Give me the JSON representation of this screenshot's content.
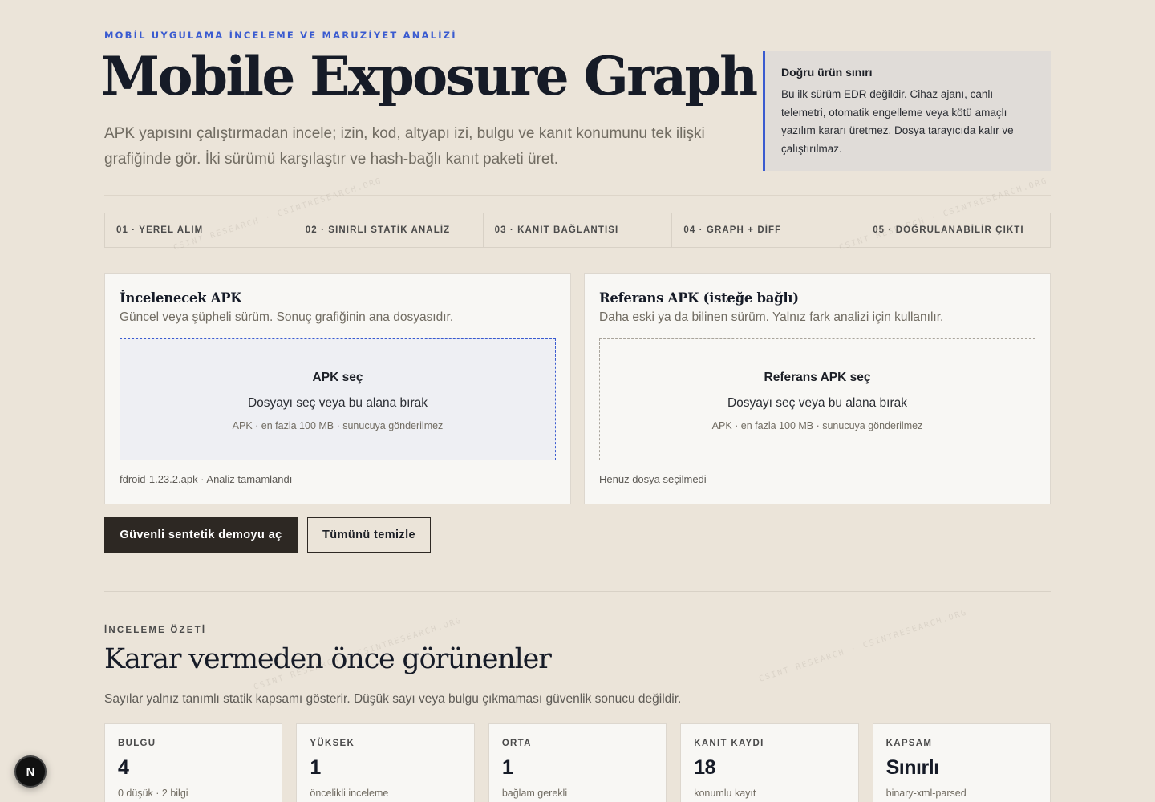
{
  "hero": {
    "eyebrow": "MOBİL UYGULAMA İNCELEME VE MARUZİYET ANALİZİ",
    "title": "Mobile Exposure Graph",
    "subtitle": "APK yapısını çalıştırmadan incele; izin, kod, altyapı izi, bulgu ve kanıt konumunu tek ilişki grafiğinde gör. İki sürümü karşılaştır ve hash-bağlı kanıt paketi üret."
  },
  "notice": {
    "title": "Doğru ürün sınırı",
    "body": "Bu ilk sürüm EDR değildir. Cihaz ajanı, canlı telemetri, otomatik engelleme veya kötü amaçlı yazılım kararı üretmez. Dosya tarayıcıda kalır ve çalıştırılmaz."
  },
  "steps": [
    {
      "label": "01 · YEREL ALIM"
    },
    {
      "label": "02 · SINIRLI STATİK ANALİZ"
    },
    {
      "label": "03 · KANIT BAĞLANTISI"
    },
    {
      "label": "04 · GRAPH + DİFF"
    },
    {
      "label": "05 · DOĞRULANABİLİR ÇIKTI"
    }
  ],
  "upload": {
    "primary": {
      "title": "İncelenecek APK",
      "description": "Güncel veya şüpheli sürüm. Sonuç grafiğinin ana dosyasıdır.",
      "drop_title": "APK seç",
      "drop_text": "Dosyayı seç veya bu alana bırak",
      "drop_meta": "APK · en fazla 100 MB · sunucuya gönderilmez",
      "status": "fdroid-1.23.2.apk · Analiz tamamlandı"
    },
    "reference": {
      "title": "Referans APK (isteğe bağlı)",
      "description": "Daha eski ya da bilinen sürüm. Yalnız fark analizi için kullanılır.",
      "drop_title": "Referans APK seç",
      "drop_text": "Dosyayı seç veya bu alana bırak",
      "drop_meta": "APK · en fazla 100 MB · sunucuya gönderilmez",
      "status": "Henüz dosya seçilmedi"
    }
  },
  "actions": {
    "demo_label": "Güvenli sentetik demoyu aç",
    "clear_label": "Tümünü temizle"
  },
  "summary": {
    "eyebrow": "İNCELEME ÖZETİ",
    "title": "Karar vermeden önce görünenler",
    "subtitle": "Sayılar yalnız tanımlı statik kapsamı gösterir. Düşük sayı veya bulgu çıkmaması güvenlik sonucu değildir.",
    "stats": [
      {
        "label": "BULGU",
        "value": "4",
        "sub": "0 düşük · 2 bilgi"
      },
      {
        "label": "YÜKSEK",
        "value": "1",
        "sub": "öncelikli inceleme"
      },
      {
        "label": "ORTA",
        "value": "1",
        "sub": "bağlam gerekli"
      },
      {
        "label": "KANIT KAYDI",
        "value": "18",
        "sub": "konumlu kayıt"
      },
      {
        "label": "KAPSAM",
        "value": "Sınırlı",
        "sub": "binary-xml-parsed"
      }
    ]
  },
  "watermark": "CSINT RESEARCH · CSINTRESEARCH.ORG",
  "badge": {
    "letter": "N"
  },
  "colors": {
    "background": "#ebe4d9",
    "accent": "#3a5bd0",
    "primary_button": "#2d2823",
    "card": "#f8f7f4"
  }
}
